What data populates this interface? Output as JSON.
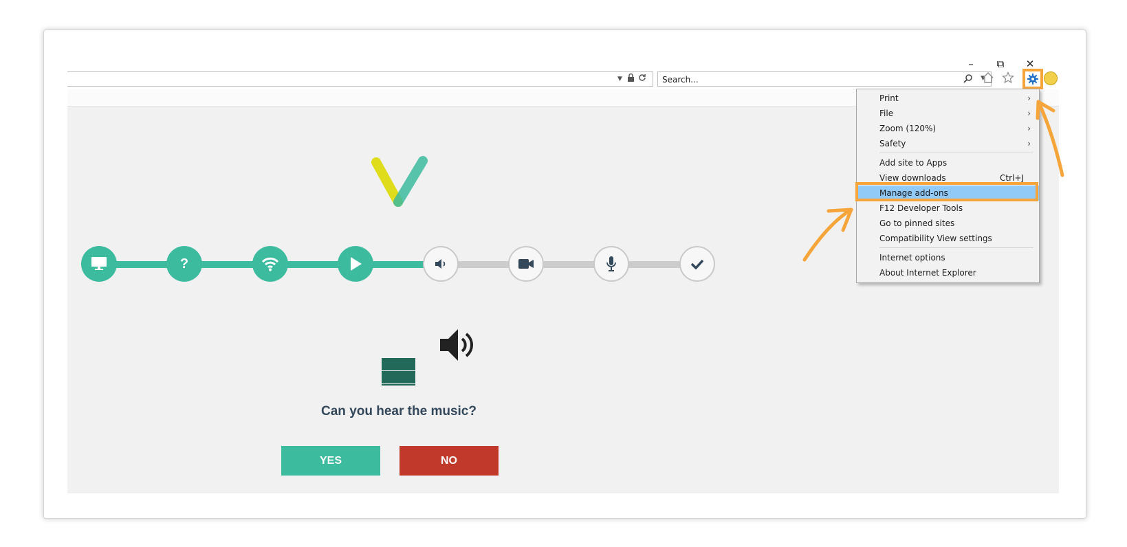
{
  "window": {
    "minimize": "–",
    "restore": "⧉",
    "close": "✕"
  },
  "toolbar": {
    "search_placeholder": "Search...",
    "search_icon": "search-icon",
    "home_icon": "home-icon",
    "favorites_icon": "star-icon",
    "tools_icon": "gear-icon",
    "feedback_icon": "smiley-icon"
  },
  "steps": [
    {
      "icon": "monitor-icon",
      "state": "done"
    },
    {
      "icon": "question-icon",
      "state": "done"
    },
    {
      "icon": "wifi-icon",
      "state": "done"
    },
    {
      "icon": "play-icon",
      "state": "done"
    },
    {
      "icon": "volume-icon",
      "state": "todo"
    },
    {
      "icon": "video-camera-icon",
      "state": "todo"
    },
    {
      "icon": "microphone-icon",
      "state": "todo"
    },
    {
      "icon": "check-icon",
      "state": "todo"
    }
  ],
  "main": {
    "question": "Can you hear the music?",
    "yes_label": "YES",
    "no_label": "NO"
  },
  "menu": {
    "print": "Print",
    "file": "File",
    "zoom": "Zoom (120%)",
    "safety": "Safety",
    "add_site": "Add site to Apps",
    "view_downloads": "View downloads",
    "view_downloads_shortcut": "Ctrl+J",
    "manage_addons": "Manage add-ons",
    "dev_tools": "F12 Developer Tools",
    "pinned_sites": "Go to pinned sites",
    "compat_view": "Compatibility View settings",
    "internet_options": "Internet options",
    "about": "About Internet Explorer"
  },
  "colors": {
    "accent": "#3dbb9f",
    "no": "#c0392b",
    "highlight": "#f5a53a",
    "menu_selected": "#91c9f7"
  }
}
